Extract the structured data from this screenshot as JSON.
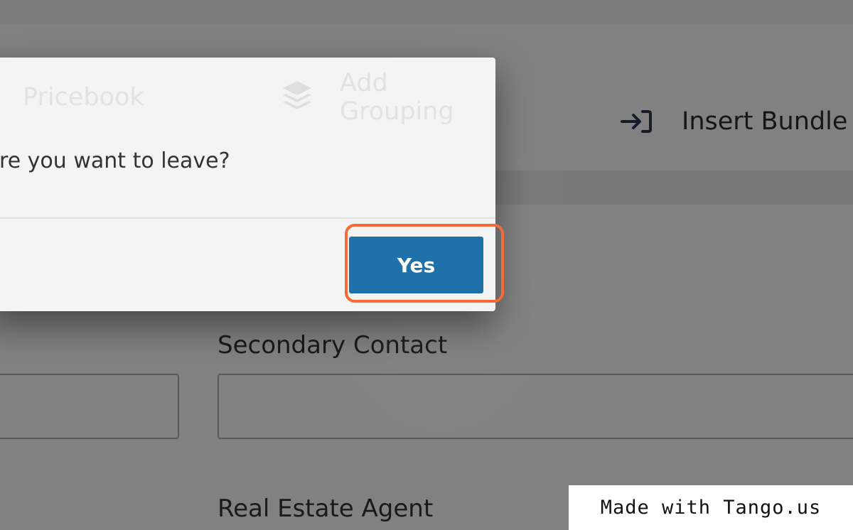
{
  "toolbar": {
    "pricebook_label": "Pricebook",
    "add_grouping_label": "Add Grouping",
    "insert_bundle_label": "Insert Bundle"
  },
  "form": {
    "secondary_contact_label": "Secondary Contact",
    "real_estate_agent_label": "Real Estate Agent"
  },
  "modal": {
    "message": "ure you want to leave?",
    "yes_label": "Yes"
  },
  "watermark": {
    "text": "Made with Tango.us"
  },
  "colors": {
    "primary_button": "#1f72a9",
    "highlight_ring": "#f56a36"
  },
  "icons": {
    "add_grouping": "layers-icon",
    "insert_bundle": "sign-in-icon"
  }
}
